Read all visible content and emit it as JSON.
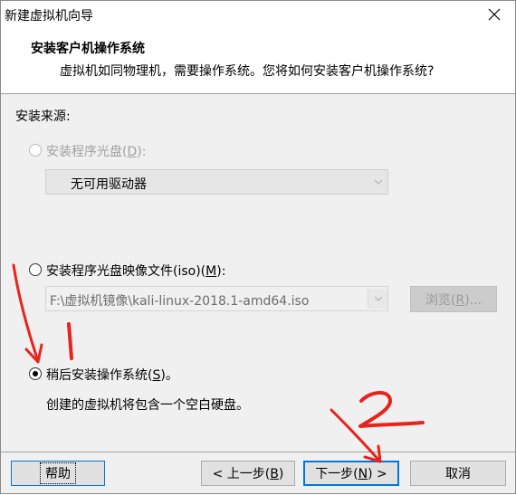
{
  "window": {
    "title": "新建虚拟机向导"
  },
  "header": {
    "title": "安装客户机操作系统",
    "subtitle": "虚拟机如同物理机，需要操作系统。您将如何安装客户机操作系统?"
  },
  "source": {
    "label": "安装来源:",
    "option_disc": {
      "prefix": "安装程序光盘(",
      "key": "D",
      "suffix": "):"
    },
    "drive_combo": {
      "value": "无可用驱动器"
    },
    "option_iso": {
      "prefix": "安装程序光盘映像文件(iso)(",
      "key": "M",
      "suffix": "):"
    },
    "iso_combo": {
      "value": "F:\\虚拟机镜像\\kali-linux-2018.1-amd64.iso"
    },
    "browse": {
      "prefix": "浏览(",
      "key": "R",
      "suffix": ")..."
    },
    "option_later": {
      "prefix": "稍后安装操作系统(",
      "key": "S",
      "suffix": ")。"
    },
    "later_desc": "创建的虚拟机将包含一个空白硬盘。"
  },
  "footer": {
    "help": "帮助",
    "back": {
      "prefix": "< 上一步(",
      "key": "B",
      "suffix": ")"
    },
    "next": {
      "prefix": "下一步(",
      "key": "N",
      "suffix": ") >"
    },
    "cancel": "取消"
  },
  "annotations": {
    "mark1": "1",
    "mark2": "2",
    "color": "#e8231c"
  },
  "colors": {
    "accent": "#0078d7",
    "disabled_text": "#a0a0a0"
  }
}
